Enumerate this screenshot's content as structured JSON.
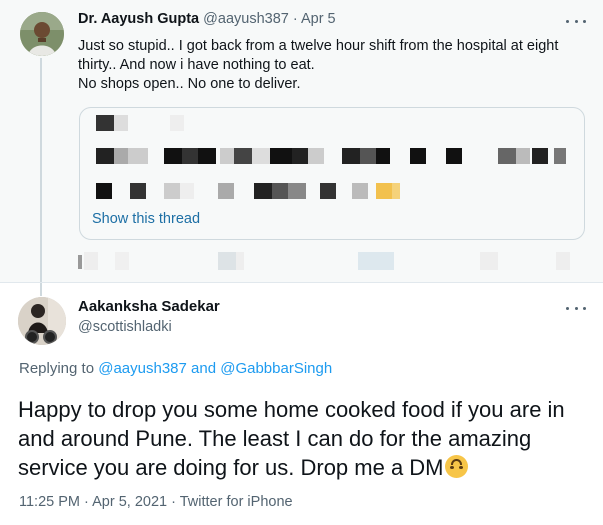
{
  "tweet1": {
    "name": "Dr. Aayush Gupta",
    "handle": "@aayush387",
    "separator": "·",
    "date": "Apr 5",
    "lines": [
      "Just so stupid.. I got back from a twelve hour shift from the hospital at eight",
      "thirty.. And now i have nothing to eat.",
      "No shops open.. No one to deliver."
    ],
    "quote": {
      "show_thread_label": "Show this thread",
      "content": "pixelated (blurred) quoted text"
    },
    "more_icon": "more-dots-icon"
  },
  "tweet2": {
    "name": "Aakanksha Sadekar",
    "handle": "@scottishladki",
    "replying_prefix": "Replying to",
    "replying_to": [
      "@aayush387",
      "@GabbbarSingh"
    ],
    "replying_joiner": "and",
    "body": "Happy to drop you some home cooked food if you are in and around Pune. The least I can do for the amazing service you are doing for us. Drop me a DM",
    "emoji_icon": "upside-down-face-emoji",
    "time": "11:25 PM",
    "separator": "·",
    "date": "Apr 5, 2021",
    "source": "Twitter for iPhone",
    "more_icon": "more-dots-icon"
  },
  "colors": {
    "text": "#0f1419",
    "secondary": "#536471",
    "link": "#1d9bf0",
    "card_border": "#cfd9de",
    "top_bg": "#f7f9f9"
  }
}
